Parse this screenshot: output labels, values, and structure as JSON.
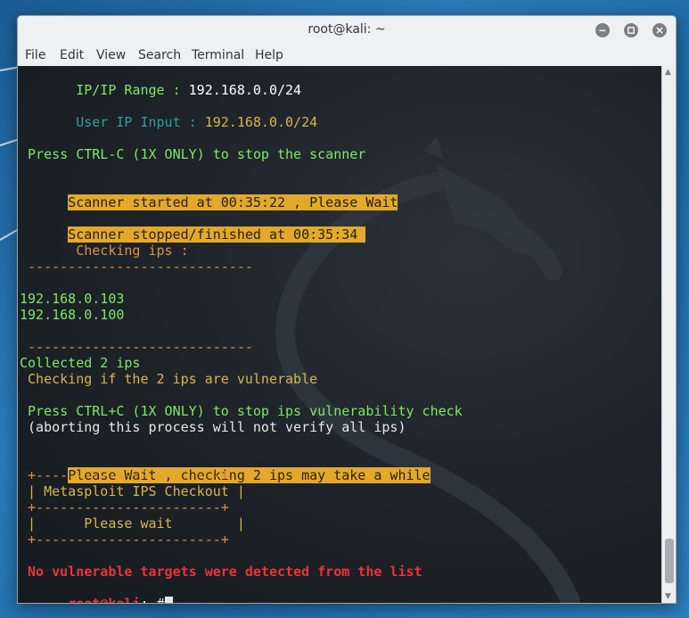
{
  "window": {
    "title": "root@kali: ~"
  },
  "menu": [
    "File",
    "Edit",
    "View",
    "Search",
    "Terminal",
    "Help"
  ],
  "terminal": {
    "ip_range_label": " IP/IP Range : ",
    "ip_range_value": "192.168.0.0/24",
    "user_ip_label": " User IP Input : ",
    "user_ip_value": "192.168.0.0/24",
    "press_ctrl_c": " Press CTRL-C (1X ONLY) to stop the scanner",
    "scanner_started": "Scanner started at 00:35:22 , Please Wait",
    "scanner_stopped": "Scanner stopped/finished at 00:35:34 ",
    "checking_ips": "       Checking ips :",
    "dash_line_1": " ----------------------------",
    "ips": [
      "192.168.0.103",
      "192.168.0.100"
    ],
    "dash_line_2": " ----------------------------",
    "collected": "Collected 2 ips",
    "checking_vuln": " Checking if the 2 ips are vulnerable",
    "press_ctrl_c_vuln": " Press CTRL+C (1X ONLY) to stop ips vulnerability check",
    "aborting": " (aborting this process will not verify all ips)",
    "please_wait_checking": "Please Wait , checking 2 ips may take a while",
    "box_top": " +-----------------------+",
    "box_title": " | Metasploit IPS Checkout |",
    "box_mid": " +-----------------------+",
    "box_wait": " |      Please wait        |",
    "box_bottom": " +-----------------------+",
    "no_vuln": " No vulnerable targets were detected from the list",
    "prompt_user": "root@kali",
    "prompt_rest": ":~#"
  },
  "icons": {
    "minimize": "minimize-icon",
    "maximize": "maximize-icon",
    "close": "close-icon"
  }
}
